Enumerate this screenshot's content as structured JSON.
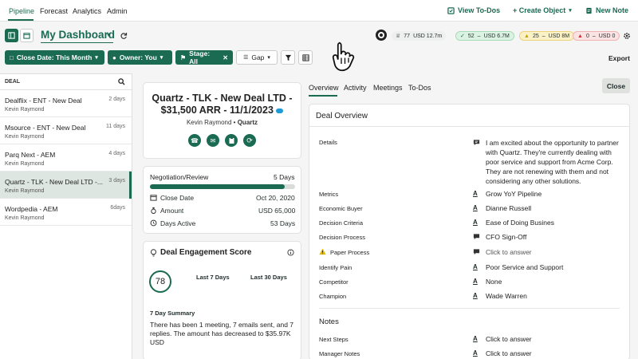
{
  "nav": {
    "tabs": [
      "Pipeline",
      "Forecast",
      "Analytics",
      "Admin"
    ],
    "view_todos": "View To-Dos",
    "create_object": "+ Create Object",
    "new_note": "New Note"
  },
  "dashboard": {
    "title": "My Dashboard",
    "pills": [
      {
        "count": "77",
        "amount": "USD 12.7m"
      },
      {
        "count": "52",
        "amount": "USD 6.7M"
      },
      {
        "count": "25",
        "amount": "USD 8M"
      },
      {
        "count": "0",
        "amount": "USD 0"
      }
    ]
  },
  "filters": {
    "close_date": "Close Date: This Month",
    "owner": "Owner: You",
    "stage": "Stage: All",
    "gap": "Gap",
    "export": "Export"
  },
  "deal_list": {
    "header": "DEAL",
    "items": [
      {
        "name": "Dealflix - ENT - New Deal",
        "owner": "Kevin Raymond",
        "days": "2 days"
      },
      {
        "name": "Msource - ENT - New Deal",
        "owner": "Kevin Raymond",
        "days": "11 days"
      },
      {
        "name": "Parq Next - AEM",
        "owner": "Kevin Raymond",
        "days": "4 days"
      },
      {
        "name": "Quartz - TLK - New Deal LTD -...",
        "owner": "Kevin Raymond",
        "days": "3 days"
      },
      {
        "name": "Wordpedia - AEM",
        "owner": "Kevin Raymond",
        "days": "6days"
      }
    ]
  },
  "deal": {
    "title_line1": "Quartz - TLK - New Deal LTD -",
    "title_line2": "$31,500 ARR - 11/1/2023",
    "owner": "Kevin Raymond",
    "sep": "•",
    "company": "Quartz"
  },
  "stage": {
    "name": "Negotiation/Review",
    "days": "5 Days",
    "progress": 0.93,
    "close_date_label": "Close Date",
    "close_date": "Oct 20, 2020",
    "amount_label": "Amount",
    "amount": "USD 65,000",
    "days_active_label": "Days Active",
    "days_active": "53 Days"
  },
  "engagement": {
    "title": "Deal Engagement Score",
    "score": "78",
    "last7": "Last 7 Days",
    "last30": "Last 30 Days",
    "summary_title": "7 Day Summary",
    "summary_l1": "There has been 1 meeting, 7 emails sent, and 7",
    "summary_l2": "replies. The amount has decreased to $35.97K",
    "summary_l3": "USD"
  },
  "detail_tabs": {
    "tabs": [
      "Overview",
      "Activity",
      "Meetings",
      "To-Dos"
    ],
    "close": "Close"
  },
  "overview": {
    "title": "Deal Overview",
    "details_label": "Details",
    "details_lines": [
      "I am excited about the opportunity to partner",
      "with Quartz. They're currently dealing with",
      "poor service and support from Acme Corp.",
      "They are not renewing with them and not",
      "considering any other solutions."
    ],
    "fields": [
      {
        "label": "Metrics",
        "value": "Grow YoY Pipeline"
      },
      {
        "label": "Economic Buyer",
        "value": "Dianne Russell"
      },
      {
        "label": "Decision Criteria",
        "value": "Ease of Doing Busines"
      },
      {
        "label": "Decision Process",
        "value": "CFO Sign-Off"
      },
      {
        "label": "Paper Process",
        "value": "Click to answer"
      },
      {
        "label": "Identify Pain",
        "value": "Poor Service and Support"
      },
      {
        "label": "Competitor",
        "value": "None"
      },
      {
        "label": "Champion",
        "value": "Wade Warren"
      }
    ],
    "notes_title": "Notes",
    "notes_fields": [
      {
        "label": "Next Steps",
        "value": "Click to answer"
      },
      {
        "label": "Manager Notes",
        "value": "Click to answer"
      }
    ]
  },
  "colors": {
    "brand": "#1a6b52",
    "warning": "#e6b800"
  }
}
